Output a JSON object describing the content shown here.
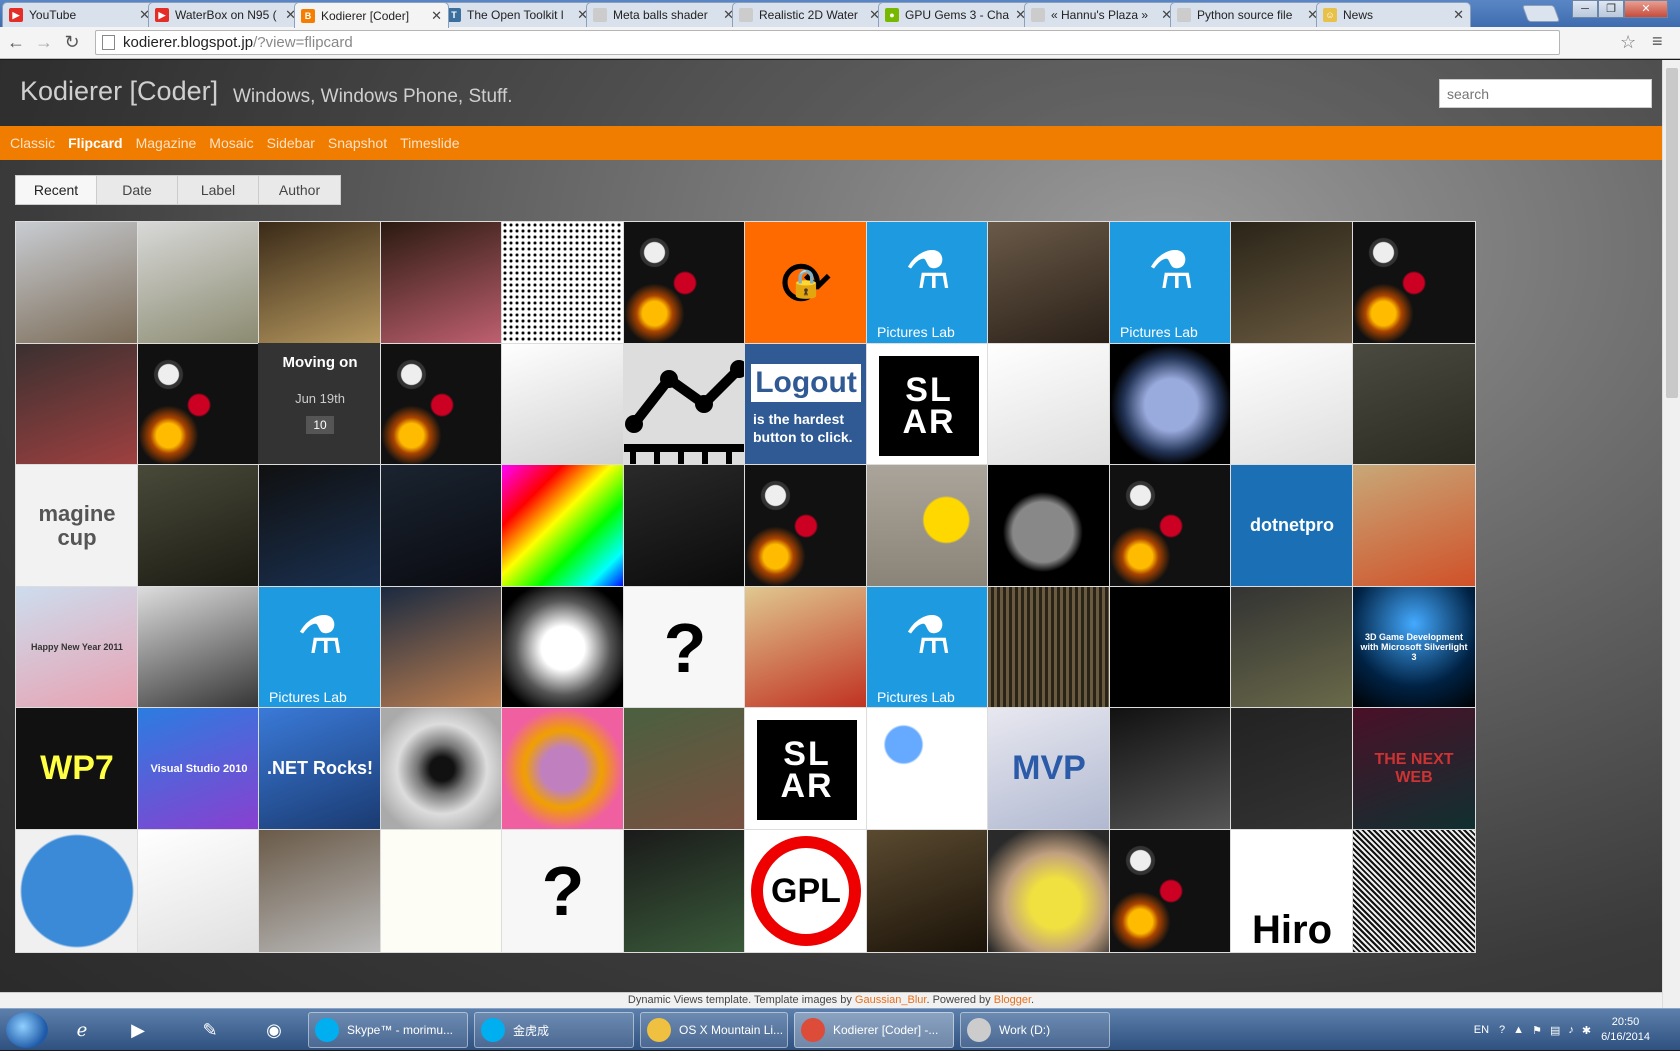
{
  "browser": {
    "tabs": [
      {
        "title": "YouTube",
        "color": "#e52d27",
        "glyph": "▶"
      },
      {
        "title": "WaterBox on N95 (",
        "color": "#e52d27",
        "glyph": "▶"
      },
      {
        "title": "Kodierer [Coder]",
        "color": "#f57d00",
        "glyph": "B"
      },
      {
        "title": "The Open Toolkit l",
        "color": "#3a6f9e",
        "glyph": "T"
      },
      {
        "title": "Meta balls shader",
        "color": "#cccccc",
        "glyph": ""
      },
      {
        "title": "Realistic 2D Water",
        "color": "#cccccc",
        "glyph": ""
      },
      {
        "title": "GPU Gems 3 - Cha",
        "color": "#76b900",
        "glyph": "●"
      },
      {
        "title": "« Hannu's Plaza »",
        "color": "#cccccc",
        "glyph": ""
      },
      {
        "title": "Python source file",
        "color": "#cccccc",
        "glyph": ""
      },
      {
        "title": "News",
        "color": "#e8c14a",
        "glyph": "☺"
      }
    ],
    "active_tab": 2,
    "url_host": "kodierer.blogspot.jp",
    "url_path": "/?view=flipcard"
  },
  "blog": {
    "title": "Kodierer [Coder]",
    "description": "Windows, Windows Phone, Stuff.",
    "search_placeholder": "search",
    "views": [
      "Classic",
      "Flipcard",
      "Magazine",
      "Mosaic",
      "Sidebar",
      "Snapshot",
      "Timeslide"
    ],
    "active_view": "Flipcard",
    "sort_tabs": [
      "Recent",
      "Date",
      "Label",
      "Author"
    ],
    "active_sort": "Recent",
    "date_card": {
      "title": "Moving on",
      "date": "Jun 19th",
      "count": "10"
    },
    "pictures_lab_caption": "Pictures Lab",
    "logout_text_1": "Logout",
    "logout_text_2": "is the hardest button to click.",
    "mvp_text": "MVP",
    "net_rocks_text": ".NET Rocks!",
    "vs_text": "Visual Studio 2010",
    "dotnetpro_text": "dotnetpro",
    "hiro_text": "Hiro",
    "gpl_text": "GPL",
    "silverlight_text": "3D Game Development with Microsoft Silverlight 3",
    "wp7_text": "WP7",
    "imaginecup_text": "magine cup",
    "slar_text": "SL AR",
    "nextweb_text": "THE NEXT WEB",
    "happy_text": "Happy New Year 2011"
  },
  "footer": {
    "prefix": "Dynamic Views template. Template images by ",
    "author": "Gaussian_Blur",
    "middle": ". Powered by ",
    "powered": "Blogger",
    "suffix": "."
  },
  "taskbar": {
    "tasks": [
      {
        "label": "Skype™ - morimu...",
        "color": "#00aff0"
      },
      {
        "label": "金虎成",
        "color": "#00aff0"
      },
      {
        "label": "OS X Mountain Li...",
        "color": "#f0c040"
      },
      {
        "label": "Kodierer [Coder] -...",
        "color": "#dd4b39"
      },
      {
        "label": "Work (D:)",
        "color": "#cccccc"
      }
    ],
    "lang": "EN",
    "time": "20:50",
    "date": "6/16/2014"
  }
}
